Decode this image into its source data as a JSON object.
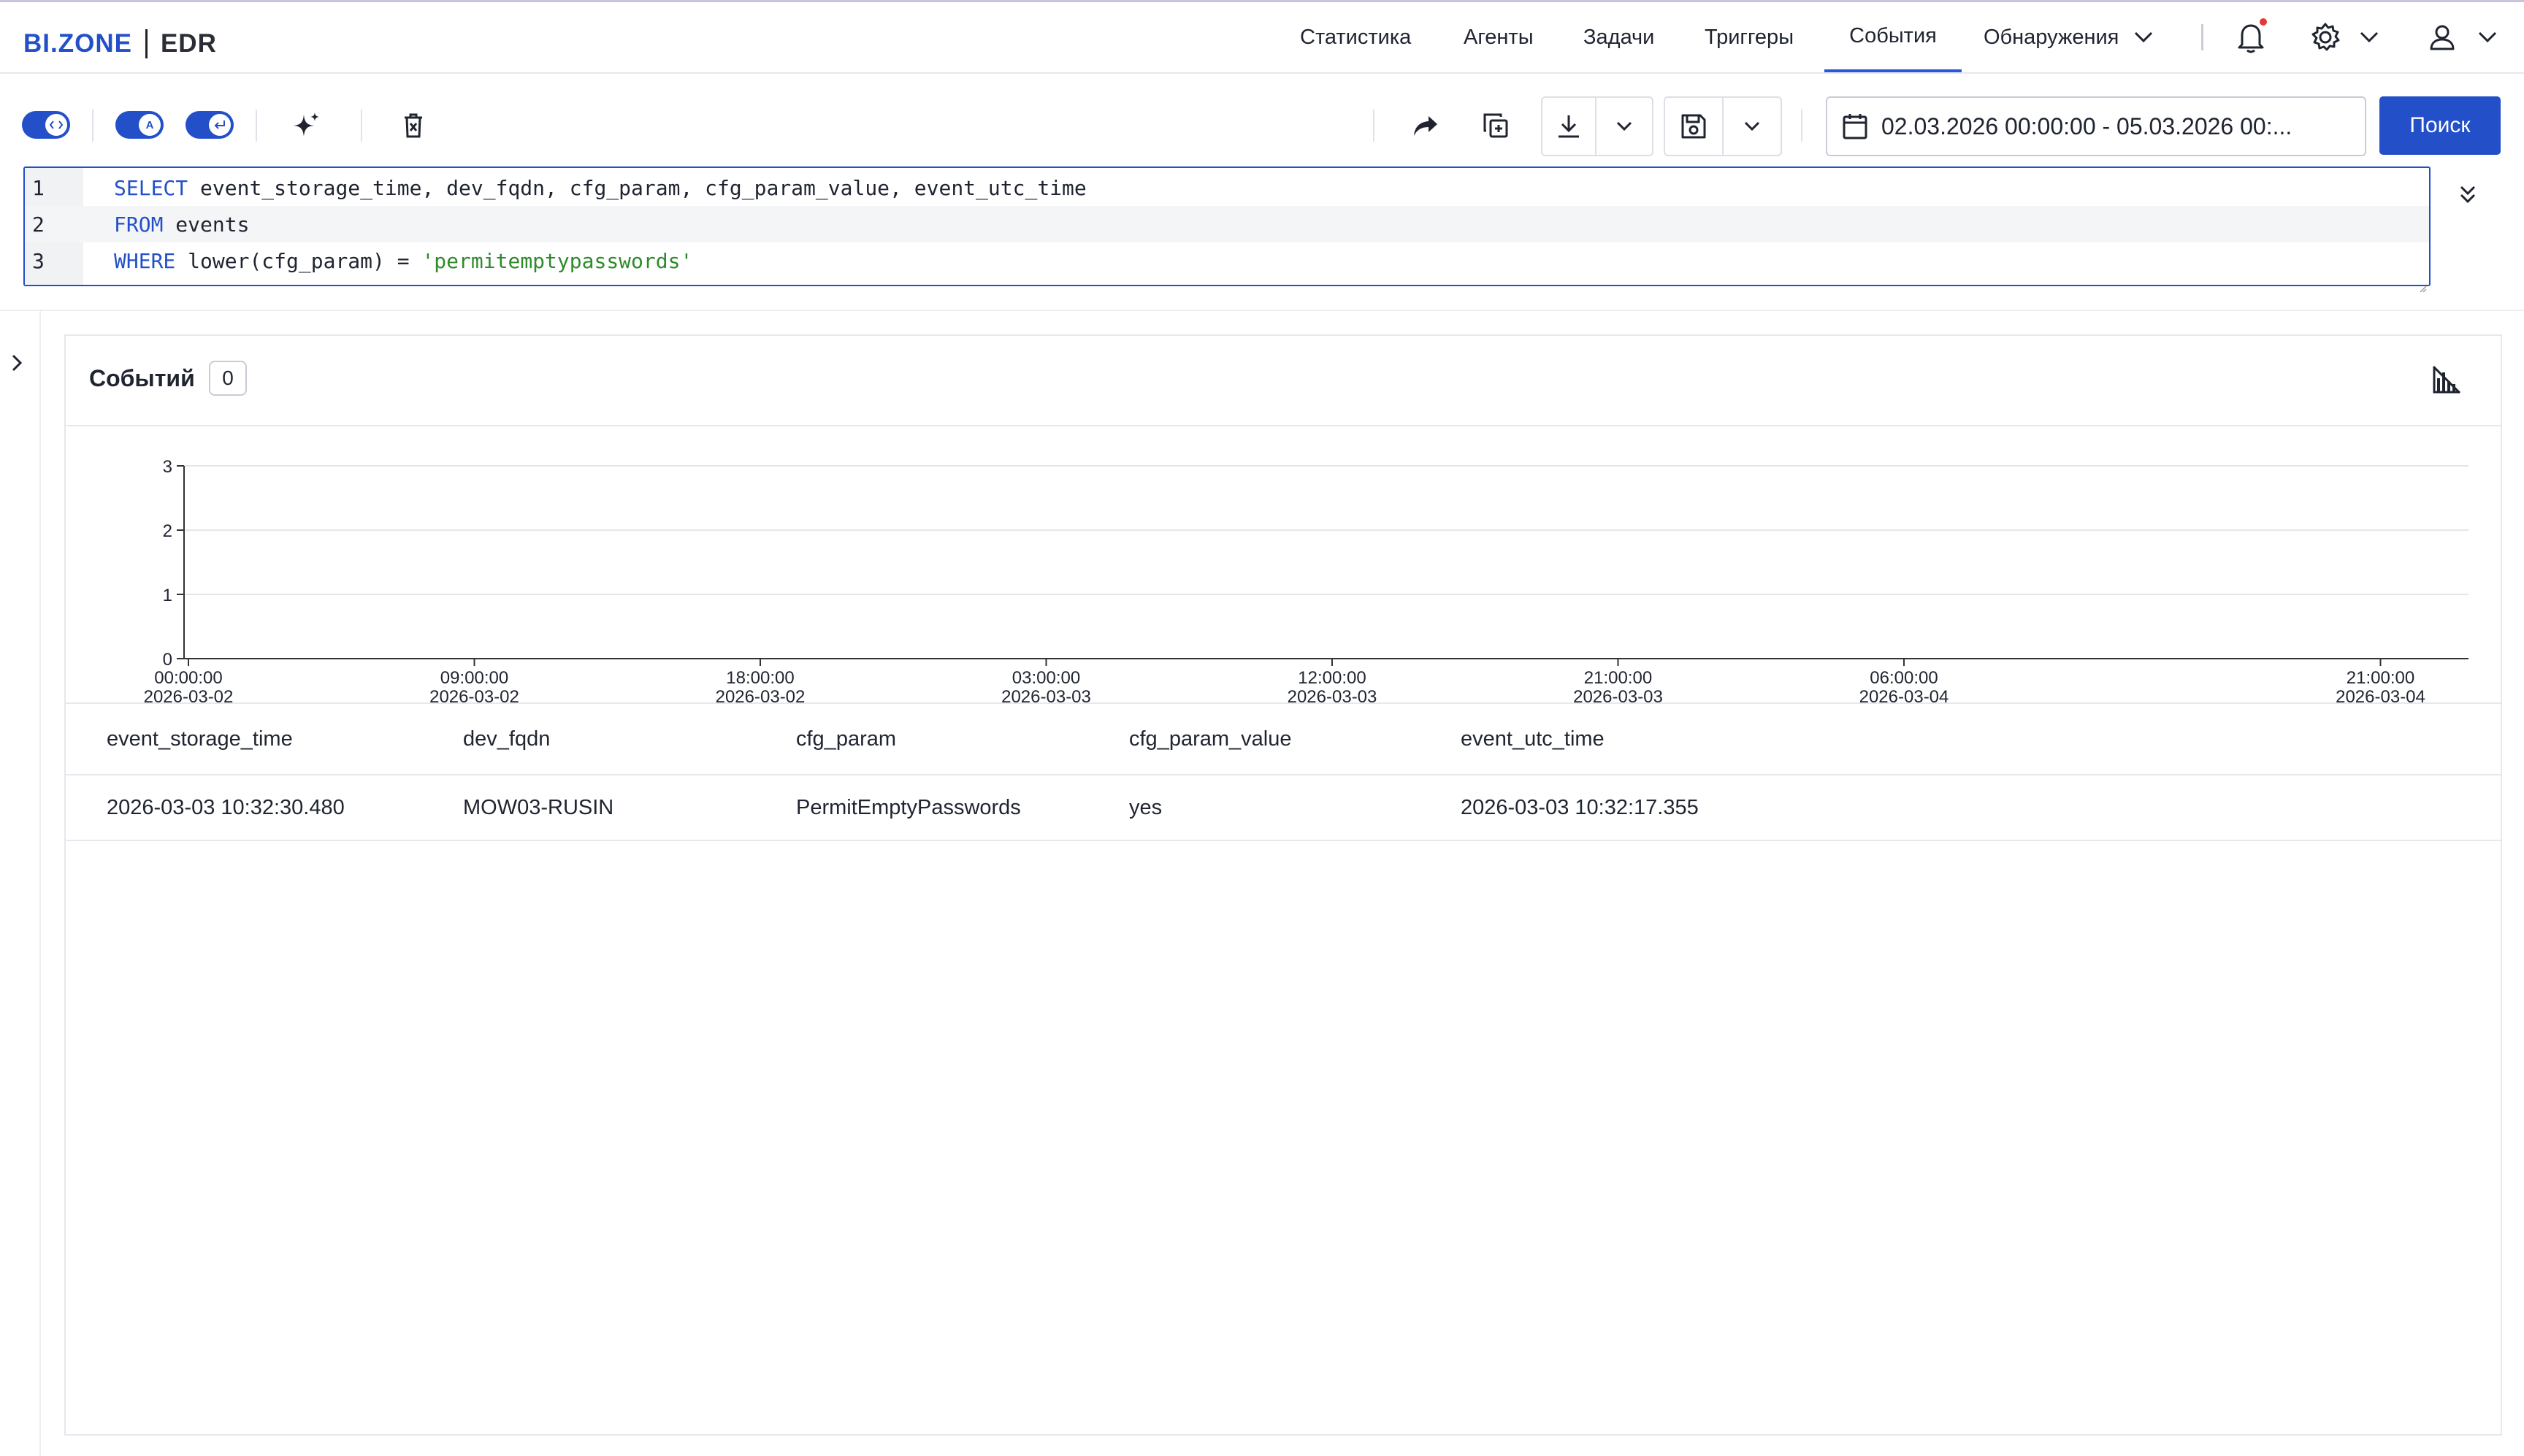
{
  "header": {
    "logo_brand": "BI.ZONE",
    "logo_product": "EDR",
    "nav": [
      {
        "label": "Статистика"
      },
      {
        "label": "Агенты"
      },
      {
        "label": "Задачи"
      },
      {
        "label": "Триггеры"
      },
      {
        "label": "События",
        "active": true
      },
      {
        "label": "Обнаружения"
      }
    ],
    "icons": [
      "bell-icon",
      "gear-icon",
      "user-icon"
    ]
  },
  "toolbar": {
    "date_range": "02.03.2026 00:00:00 - 05.03.2026 00:...",
    "search_label": "Поиск",
    "toggle_auto_label": "A",
    "accent_color": "#2350c9"
  },
  "editor": {
    "lines": [
      {
        "num": "1",
        "keyword": "SELECT",
        "text": " event_storage_time, dev_fqdn, cfg_param, cfg_param_value, event_utc_time",
        "string": ""
      },
      {
        "num": "2",
        "keyword": "FROM",
        "text": " events",
        "string": ""
      },
      {
        "num": "3",
        "keyword": "WHERE",
        "text": " lower(cfg_param) = ",
        "string": "'permitemptypasswords'"
      }
    ]
  },
  "results": {
    "title": "Событий",
    "count": "0",
    "columns": [
      "event_storage_time",
      "dev_fqdn",
      "cfg_param",
      "cfg_param_value",
      "event_utc_time"
    ],
    "rows": [
      [
        "2026-03-03 10:32:30.480",
        "MOW03-RUSIN",
        "PermitEmptyPasswords",
        "yes",
        "2026-03-03 10:32:17.355"
      ]
    ]
  },
  "chart_data": {
    "type": "bar",
    "title": "",
    "xlabel": "",
    "ylabel": "",
    "ylim": [
      0,
      3
    ],
    "yticks": [
      "0",
      "1",
      "2",
      "3"
    ],
    "xticks": [
      {
        "time": "00:00:00",
        "date": "2026-03-02"
      },
      {
        "time": "09:00:00",
        "date": "2026-03-02"
      },
      {
        "time": "18:00:00",
        "date": "2026-03-02"
      },
      {
        "time": "03:00:00",
        "date": "2026-03-03"
      },
      {
        "time": "12:00:00",
        "date": "2026-03-03"
      },
      {
        "time": "21:00:00",
        "date": "2026-03-03"
      },
      {
        "time": "06:00:00",
        "date": "2026-03-04"
      },
      {
        "time": "21:00:00",
        "date": "2026-03-04"
      }
    ],
    "values": [],
    "grid": true
  }
}
